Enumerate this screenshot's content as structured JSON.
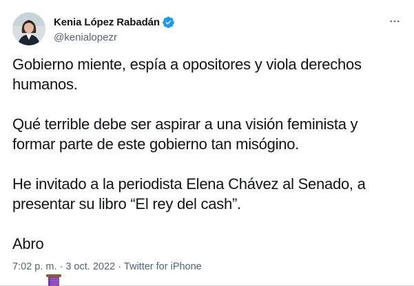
{
  "author": {
    "display_name": "Kenia López Rabadán",
    "handle": "@kenialopezr",
    "verified_icon": "verified-badge-icon",
    "avatar": "profile-photo"
  },
  "more_icon": "more-horizontal-icon",
  "tweet": {
    "paragraphs": [
      "Gobierno miente, espía a opositores y viola derechos\nhumanos.",
      "Qué terrible debe ser aspirar a una visión feminista y\nformar parte de este gobierno tan misógino.",
      "He invitado a la periodista Elena Chávez al Senado, a\npresentar su libro “El rey del cash”."
    ],
    "last_line_text": "Abro",
    "last_line_emoji": "spool-of-thread-emoji"
  },
  "meta": {
    "time": "7:02 p. m.",
    "separator": "·",
    "date": "3 oct. 2022",
    "source": "Twitter for iPhone"
  },
  "colors": {
    "text": "#0f1419",
    "secondary": "#536471",
    "verified": "#1d9bf0"
  }
}
